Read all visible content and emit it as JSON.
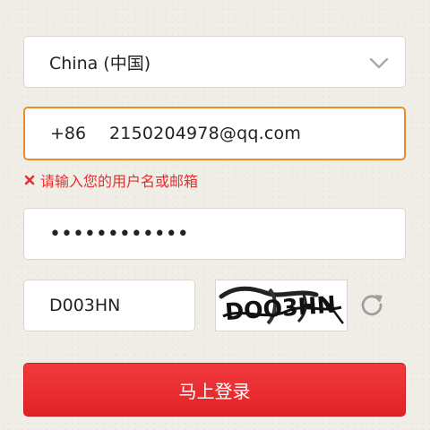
{
  "country_select": {
    "value": "China (中国)",
    "icon": "chevron-down-icon"
  },
  "account": {
    "prefix": "+86",
    "value": "2150204978@qq.com"
  },
  "error": {
    "icon": "error-x-icon",
    "message": "请输入您的用户名或邮箱"
  },
  "password": {
    "masked_value": "••••••••••••"
  },
  "captcha": {
    "value": "D003HN",
    "image_text": "DOO3HN",
    "refresh_icon": "refresh-icon"
  },
  "login_button": {
    "label": "马上登录"
  },
  "colors": {
    "error": "#e03131",
    "accent_border": "#f08a24",
    "button": "#e62a2e"
  }
}
